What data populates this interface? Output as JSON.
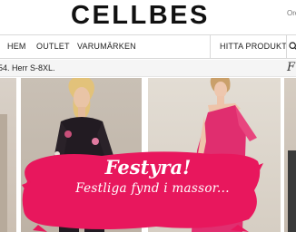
{
  "header": {
    "logo": "CELLBES",
    "right_link": "Order"
  },
  "nav": {
    "items": [
      {
        "label": "HEM"
      },
      {
        "label": "OUTLET"
      },
      {
        "label": "VARUMÄRKEN"
      }
    ],
    "right_item": "HITTA PRODUKT",
    "search_icon": "search-icon"
  },
  "promo": {
    "text": "54. Herr S-8XL.",
    "right_glyph": "F"
  },
  "banner": {
    "title": "Festyra!",
    "subtitle": "Festliga fynd i massor...",
    "color": "#e8175d"
  },
  "photos": [
    {
      "description_icon": "model-photo-partial"
    },
    {
      "description_icon": "model-photo-floral-suit"
    },
    {
      "description_icon": "model-photo-pink-dress"
    },
    {
      "description_icon": "model-photo-partial"
    }
  ]
}
